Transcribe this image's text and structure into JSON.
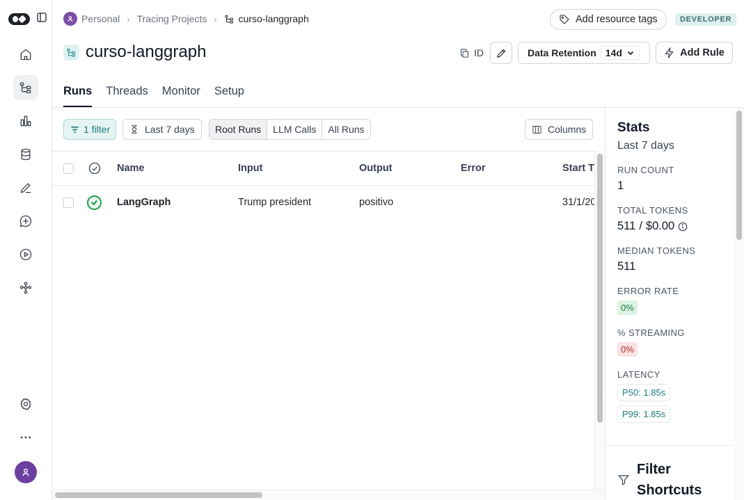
{
  "breadcrumb": {
    "workspace": "Personal",
    "section": "Tracing Projects",
    "current": "curso-langgraph"
  },
  "header": {
    "add_tags_label": "Add resource tags",
    "role_badge": "DEVELOPER",
    "title": "curso-langgraph",
    "id_label": "ID",
    "retention_label": "Data Retention",
    "retention_value": "14d",
    "add_rule_label": "Add Rule"
  },
  "tabs": [
    {
      "label": "Runs",
      "active": true
    },
    {
      "label": "Threads",
      "active": false
    },
    {
      "label": "Monitor",
      "active": false
    },
    {
      "label": "Setup",
      "active": false
    }
  ],
  "toolbar": {
    "filter_label": "1 filter",
    "range_label": "Last 7 days",
    "run_types": [
      "Root Runs",
      "LLM Calls",
      "All Runs"
    ],
    "active_run_type": "Root Runs",
    "columns_label": "Columns"
  },
  "table": {
    "columns": [
      "Name",
      "Input",
      "Output",
      "Error",
      "Start T"
    ],
    "rows": [
      {
        "status": "success",
        "name": "LangGraph",
        "input": "Trump president",
        "output": "positivo",
        "error": "",
        "start_time": "31/1/20"
      }
    ]
  },
  "stats": {
    "title": "Stats",
    "range": "Last 7 days",
    "run_count_label": "RUN COUNT",
    "run_count": "1",
    "total_tokens_label": "TOTAL TOKENS",
    "total_tokens": "511",
    "total_cost": "$0.00",
    "median_tokens_label": "MEDIAN TOKENS",
    "median_tokens": "511",
    "error_rate_label": "ERROR RATE",
    "error_rate": "0%",
    "streaming_label": "% STREAMING",
    "streaming": "0%",
    "latency_label": "LATENCY",
    "p50": "P50: 1.85s",
    "p99": "P99: 1.85s",
    "filter_shortcuts_title": "Filter Shortcuts"
  },
  "colors": {
    "accent": "#1e7a7a",
    "success": "#1e9e4a",
    "error_pill": "#fbe2e3",
    "success_pill": "#dcf3e3"
  }
}
